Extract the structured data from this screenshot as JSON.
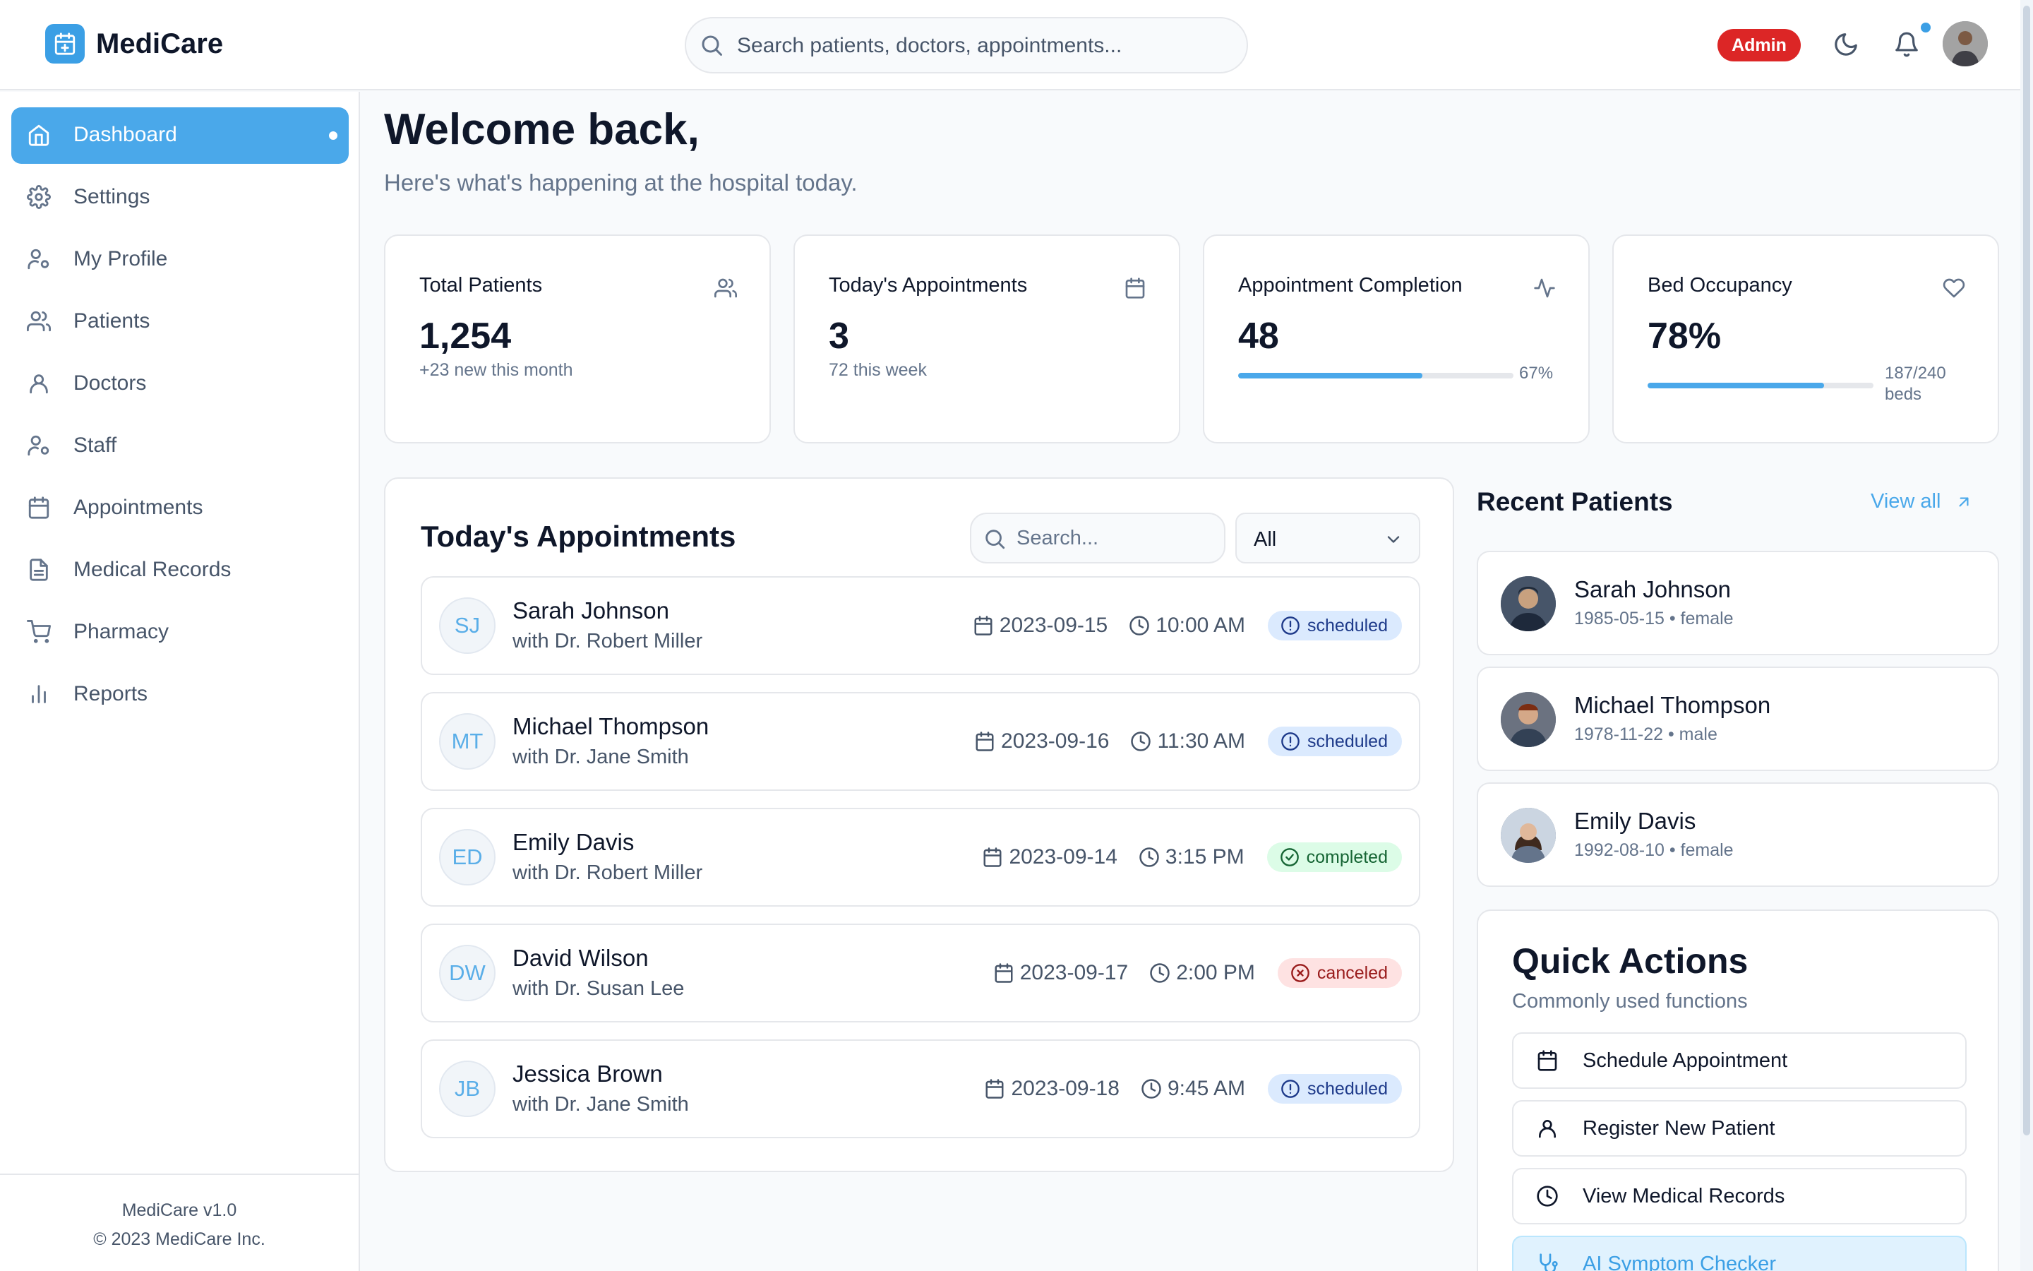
{
  "app": {
    "name": "MediCare",
    "role_badge": "Admin"
  },
  "search": {
    "placeholder": "Search patients, doctors, appointments..."
  },
  "sidebar": {
    "items": [
      {
        "label": "Dashboard",
        "icon": "home-icon",
        "active": true
      },
      {
        "label": "Settings",
        "icon": "gear-icon"
      },
      {
        "label": "My Profile",
        "icon": "user-cog-icon"
      },
      {
        "label": "Patients",
        "icon": "users-icon"
      },
      {
        "label": "Doctors",
        "icon": "user-icon"
      },
      {
        "label": "Staff",
        "icon": "user-cog-icon"
      },
      {
        "label": "Appointments",
        "icon": "calendar-icon"
      },
      {
        "label": "Medical Records",
        "icon": "file-text-icon"
      },
      {
        "label": "Pharmacy",
        "icon": "shopping-cart-icon"
      },
      {
        "label": "Reports",
        "icon": "bar-chart-icon"
      }
    ],
    "footer_version": "MediCare v1.0",
    "footer_copyright": "© 2023 MediCare Inc."
  },
  "welcome": {
    "title": "Welcome back,",
    "subtitle": "Here's what's happening at the hospital today."
  },
  "stats": [
    {
      "label": "Total Patients",
      "value": "1,254",
      "sub": "+23 new this month",
      "icon": "users-icon"
    },
    {
      "label": "Today's Appointments",
      "value": "3",
      "sub": "72 this week",
      "icon": "calendar-icon"
    },
    {
      "label": "Appointment Completion",
      "value": "48",
      "progress_label": "67%",
      "progress": 0.67,
      "icon": "activity-icon"
    },
    {
      "label": "Bed Occupancy",
      "value": "78%",
      "progress_label_1": "187/240",
      "progress_label_2": "beds",
      "progress": 0.78,
      "icon": "heart-icon"
    }
  ],
  "appointments": {
    "title": "Today's Appointments",
    "search_placeholder": "Search...",
    "filter_value": "All",
    "rows": [
      {
        "initials": "SJ",
        "patient": "Sarah Johnson",
        "doctor": "with Dr. Robert Miller",
        "date": "2023-09-15",
        "time": "10:00 AM",
        "status": "scheduled"
      },
      {
        "initials": "MT",
        "patient": "Michael Thompson",
        "doctor": "with Dr. Jane Smith",
        "date": "2023-09-16",
        "time": "11:30 AM",
        "status": "scheduled"
      },
      {
        "initials": "ED",
        "patient": "Emily Davis",
        "doctor": "with Dr. Robert Miller",
        "date": "2023-09-14",
        "time": "3:15 PM",
        "status": "completed"
      },
      {
        "initials": "DW",
        "patient": "David Wilson",
        "doctor": "with Dr. Susan Lee",
        "date": "2023-09-17",
        "time": "2:00 PM",
        "status": "canceled"
      },
      {
        "initials": "JB",
        "patient": "Jessica Brown",
        "doctor": "with Dr. Jane Smith",
        "date": "2023-09-18",
        "time": "9:45 AM",
        "status": "scheduled"
      }
    ]
  },
  "recent_patients": {
    "title": "Recent Patients",
    "view_all": "View all",
    "items": [
      {
        "name": "Sarah Johnson",
        "meta": "1985-05-15 • female"
      },
      {
        "name": "Michael Thompson",
        "meta": "1978-11-22 • male"
      },
      {
        "name": "Emily Davis",
        "meta": "1992-08-10 • female"
      }
    ]
  },
  "quick_actions": {
    "title": "Quick Actions",
    "subtitle": "Commonly used functions",
    "items": [
      {
        "label": "Schedule Appointment",
        "icon": "calendar-icon"
      },
      {
        "label": "Register New Patient",
        "icon": "user-icon"
      },
      {
        "label": "View Medical Records",
        "icon": "clock-icon"
      },
      {
        "label": "AI Symptom Checker",
        "icon": "stethoscope-icon"
      }
    ]
  },
  "colors": {
    "accent": "#4aa8ea",
    "admin_badge": "#dc2626",
    "scheduled": "#dbeafe",
    "completed": "#dcfce7",
    "canceled": "#fee2e2"
  }
}
